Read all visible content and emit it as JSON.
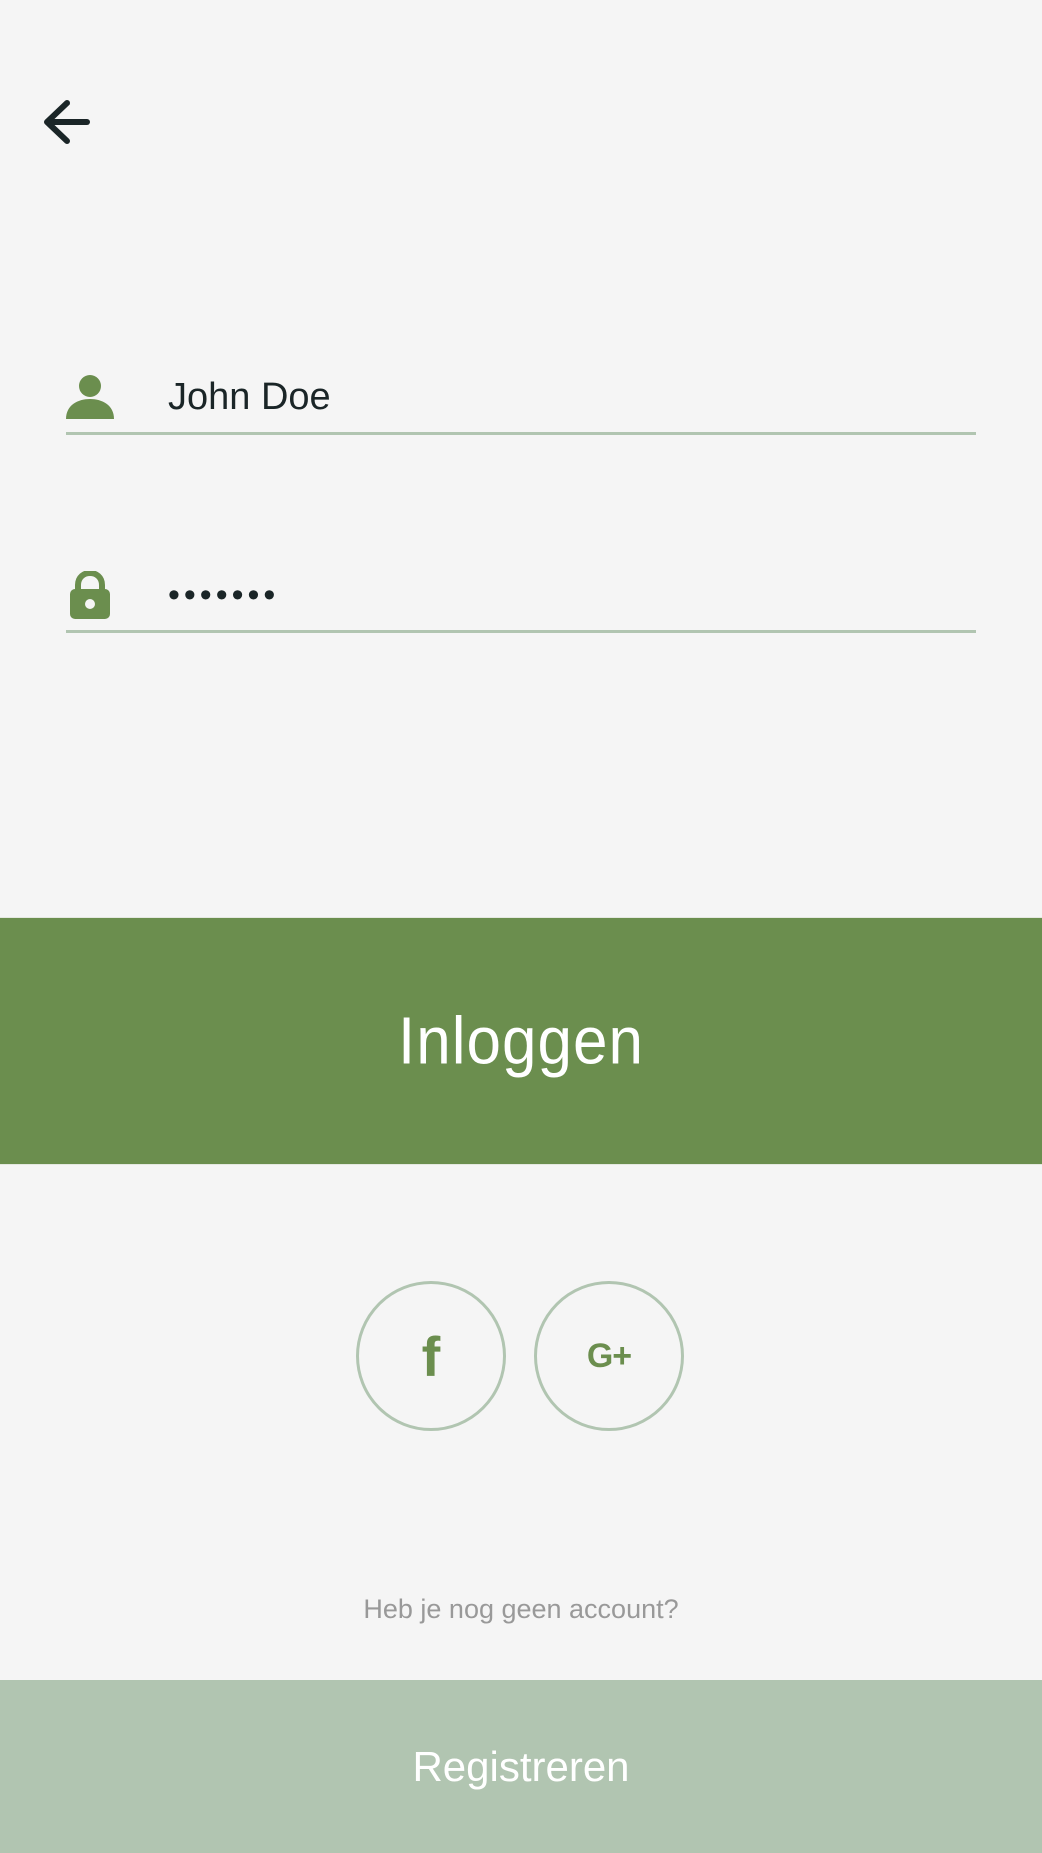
{
  "colors": {
    "background": "#f5f5f5",
    "primary": "#6b8e4e",
    "secondary": "#b1c5b1",
    "text": "#1a2527",
    "muted": "#999999"
  },
  "header": {
    "back_icon": "arrow-left-icon"
  },
  "form": {
    "username": {
      "icon": "user-icon",
      "value": "John Doe"
    },
    "password": {
      "icon": "lock-icon",
      "value": "1234567"
    }
  },
  "login_label": "Inloggen",
  "social": {
    "facebook_icon": "facebook-icon",
    "facebook_glyph": "f",
    "google_icon": "google-plus-icon",
    "google_glyph": "G+"
  },
  "no_account_text": "Heb je nog geen account?",
  "register_label": "Registreren"
}
